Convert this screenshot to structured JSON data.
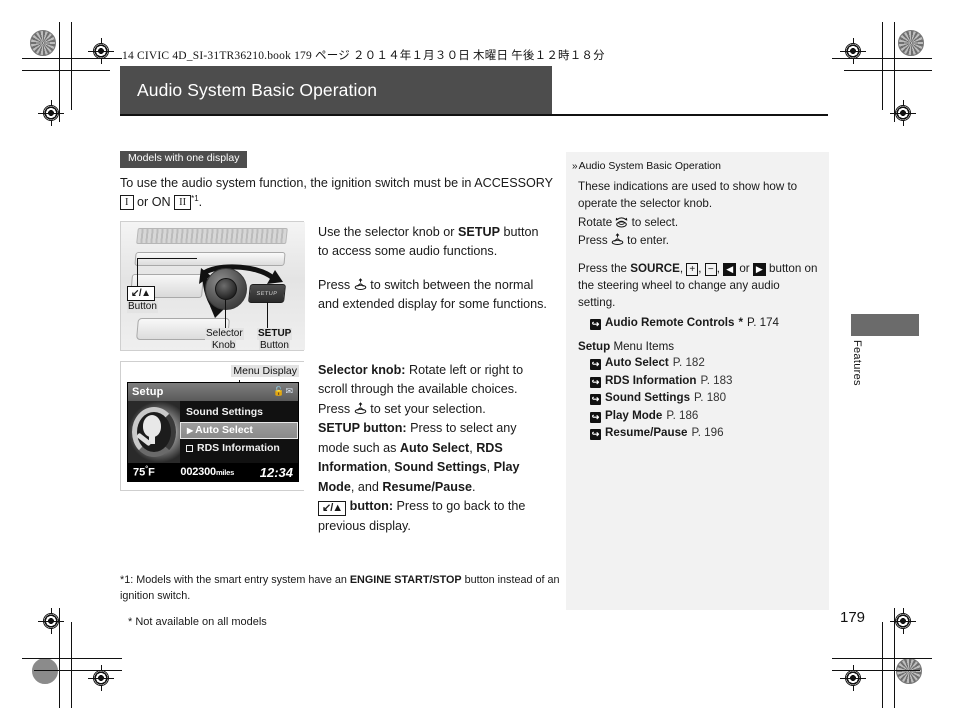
{
  "sheet": {
    "header_line": "14 CIVIC 4D_SI-31TR36210.book   179 ページ   ２０１４年１月３０日   木曜日   午後１２時１８分",
    "page_number": "179",
    "side_tab_label": "Features"
  },
  "title": {
    "text": "Audio System Basic Operation"
  },
  "left": {
    "badge": "Models with one display",
    "intro_1": "To use the audio system function, the ignition switch must be in ACCESSORY",
    "key_accessory": "I",
    "intro_2": "or",
    "intro_3": "ON",
    "key_on": "II",
    "intro_footmark": "*1",
    "intro_period": ".",
    "para_use_1": "Use the selector knob or",
    "para_use_bold": "SETUP",
    "para_use_2": "button to access some audio functions.",
    "para_press_1": "Press",
    "para_press_glyph": "knob-press-icon",
    "para_press_2": "to switch between the normal and extended display for some functions.",
    "selector_knob_label": "Selector knob:",
    "selector_knob_text_1": "Rotate left or right to scroll through the available choices. Press",
    "selector_knob_text_2": "to set your selection.",
    "setup_button_label": "SETUP button:",
    "setup_button_text_1": "Press to select any mode such as",
    "setup_opt_1": "Auto Select",
    "setup_opt_2": "RDS Information",
    "setup_opt_3": "Sound Settings",
    "setup_opt_4": "Play Mode",
    "setup_conj": "and",
    "setup_opt_5": "Resume/Pause",
    "back_button_glyph": "back-up-button-icon",
    "back_button_label": "button:",
    "back_button_text": "Press to go back to the previous display."
  },
  "figure_dash": {
    "button_callout": "Button",
    "button_glyph": "back-up-arrow-icon",
    "selector_knob_callout_line1": "Selector",
    "selector_knob_callout_line2": "Knob",
    "setup_callout_line1": "SETUP",
    "setup_callout_line2": "Button",
    "setup_btn_face": "SETUP"
  },
  "figure_display": {
    "caption": "Menu Display",
    "screen_title": "Setup",
    "status_icons": "key-and-bluetooth-icons",
    "items": [
      {
        "label": "Sound Settings",
        "selected": false,
        "checkbox": false
      },
      {
        "label": "Auto Select",
        "selected": true,
        "checkbox": false
      },
      {
        "label": "RDS Information",
        "selected": false,
        "checkbox": true
      }
    ],
    "temp": "75",
    "temp_unit": "F",
    "temp_deg": "°",
    "odometer": "002300",
    "odometer_unit": "miles",
    "clock": "12:34"
  },
  "right": {
    "heading": "Audio System Basic Operation",
    "p1": "These indications are used to show how to operate the selector knob.",
    "p2_a": "Rotate",
    "p2_glyph": "knob-rotate-icon",
    "p2_b": "to select.",
    "p3_a": "Press",
    "p3_glyph": "knob-press-icon",
    "p3_b": "to enter.",
    "p4_a": "Press the",
    "p4_source": "SOURCE",
    "p4_plus": "+",
    "p4_minus": "−",
    "p4_left": "◀",
    "p4_or": "or",
    "p4_right": "▶",
    "p4_b": "button on the steering wheel to change any audio setting.",
    "ref_label": "Audio Remote Controls",
    "ref_star": "*",
    "ref_page": "P. 174",
    "setup_menu_bold": "Setup",
    "setup_menu_rest": "Menu Items",
    "menu_items": [
      {
        "label": "Auto Select",
        "page": "P. 182"
      },
      {
        "label": "RDS Information",
        "page": "P. 183"
      },
      {
        "label": "Sound Settings",
        "page": "P. 180"
      },
      {
        "label": "Play Mode",
        "page": "P. 186"
      },
      {
        "label": "Resume/Pause",
        "page": "P. 196"
      }
    ]
  },
  "footnotes": {
    "fn1_a": "*1: Models with the smart entry system have an",
    "fn1_bold": "ENGINE START/STOP",
    "fn1_b": "button instead of an ignition switch.",
    "fn2": "* Not available on all models"
  },
  "colors": {
    "title_bar": "#4d4d4d",
    "badge": "#4d4d4d",
    "sidebar_bg": "#f2f2f2",
    "side_tab": "#6b6b6b",
    "rule": "#111111"
  }
}
